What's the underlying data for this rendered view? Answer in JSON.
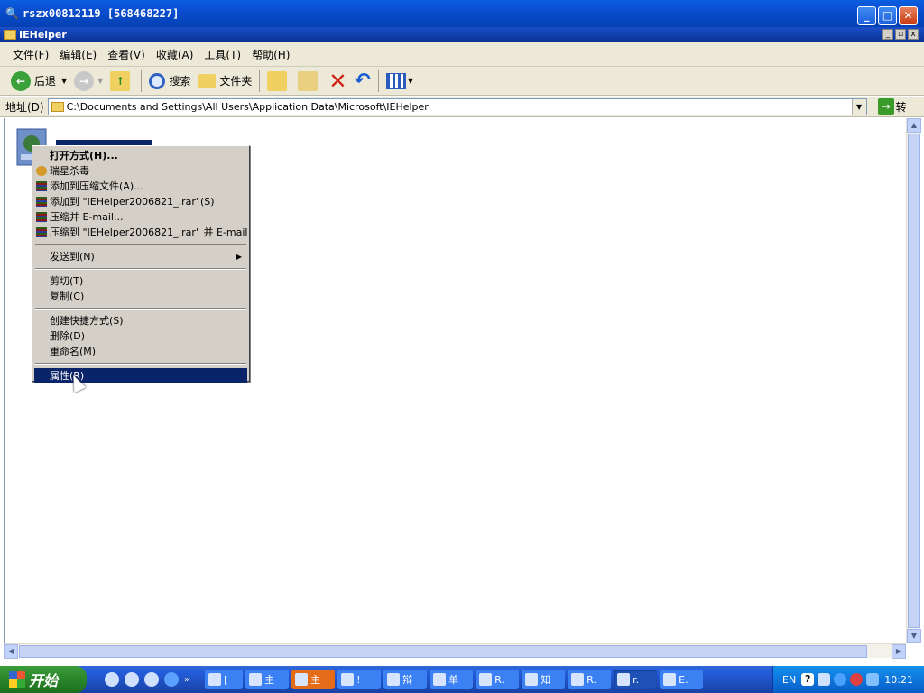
{
  "window": {
    "title": "rszx00812119 [568468227]"
  },
  "inner_window": {
    "title": "IEHelper"
  },
  "menubar": {
    "items": [
      "文件(F)",
      "编辑(E)",
      "查看(V)",
      "收藏(A)",
      "工具(T)",
      "帮助(H)"
    ]
  },
  "toolbar": {
    "back": "后退",
    "search": "搜索",
    "folders": "文件夹"
  },
  "addressbar": {
    "label": "地址(D)",
    "path": "C:\\Documents and Settings\\All Users\\Application Data\\Microsoft\\IEHelper",
    "go": "转"
  },
  "context_menu": {
    "items": [
      "打开方式(H)...",
      "瑞星杀毒",
      "添加到压缩文件(A)...",
      "添加到 \"IEHelper2006821_.rar\"(S)",
      "压缩并 E-mail...",
      "压缩到 \"IEHelper2006821_.rar\" 并 E-mail",
      "发送到(N)",
      "剪切(T)",
      "复制(C)",
      "创建快捷方式(S)",
      "删除(D)",
      "重命名(M)",
      "属性(R)"
    ]
  },
  "taskbar": {
    "start": "开始",
    "tasks": [
      "[",
      "主",
      "主",
      "!",
      "辩",
      "单",
      "R.",
      "知",
      "R.",
      "r.",
      "E."
    ],
    "tray": {
      "lang": "EN",
      "time": "10:21"
    }
  },
  "colors": {
    "selection": "#0a246a",
    "titlebar": "#0b4dcf",
    "taskbar": "#245edb",
    "start": "#2d8a2d"
  }
}
